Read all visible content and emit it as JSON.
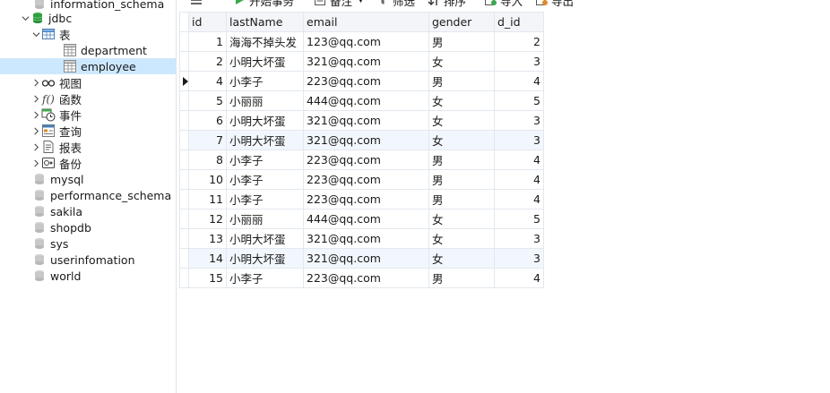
{
  "toolbar": {
    "begin_transaction": "开始事务",
    "note": "备注",
    "filter": "筛选",
    "sort": "排序",
    "import": "导入",
    "export": "导出"
  },
  "navigator": {
    "top_db": "information_schema",
    "jdbc": "jdbc",
    "tables_group": "表",
    "tables": [
      "department",
      "employee"
    ],
    "groups": [
      "视图",
      "函数",
      "事件",
      "查询",
      "报表",
      "备份"
    ],
    "other_dbs": [
      "mysql",
      "performance_schema",
      "sakila",
      "shopdb",
      "sys",
      "userinfomation",
      "world"
    ]
  },
  "grid": {
    "columns": [
      "id",
      "lastName",
      "email",
      "gender",
      "d_id"
    ],
    "rows": [
      [
        "1",
        "海海不掉头发",
        "123@qq.com",
        "男",
        "2"
      ],
      [
        "2",
        "小明大坏蛋",
        "321@qq.com",
        "女",
        "3"
      ],
      [
        "4",
        "小李子",
        "223@qq.com",
        "男",
        "4"
      ],
      [
        "5",
        "小丽丽",
        "444@qq.com",
        "女",
        "5"
      ],
      [
        "6",
        "小明大坏蛋",
        "321@qq.com",
        "女",
        "3"
      ],
      [
        "7",
        "小明大坏蛋",
        "321@qq.com",
        "女",
        "3"
      ],
      [
        "8",
        "小李子",
        "223@qq.com",
        "男",
        "4"
      ],
      [
        "10",
        "小李子",
        "223@qq.com",
        "男",
        "4"
      ],
      [
        "11",
        "小李子",
        "223@qq.com",
        "男",
        "4"
      ],
      [
        "12",
        "小丽丽",
        "444@qq.com",
        "女",
        "5"
      ],
      [
        "13",
        "小明大坏蛋",
        "321@qq.com",
        "女",
        "3"
      ],
      [
        "14",
        "小明大坏蛋",
        "321@qq.com",
        "女",
        "3"
      ],
      [
        "15",
        "小李子",
        "223@qq.com",
        "男",
        "4"
      ]
    ],
    "current_row_index": 2,
    "highlighted_rows": [
      5,
      11
    ]
  },
  "colors": {
    "selection": "#cce8ff",
    "row_highlight": "#f2f7fd",
    "db_icon": "#c8c8c8",
    "db_icon_active": "#2e9e3e",
    "grid_line": "#e2e8ef"
  }
}
